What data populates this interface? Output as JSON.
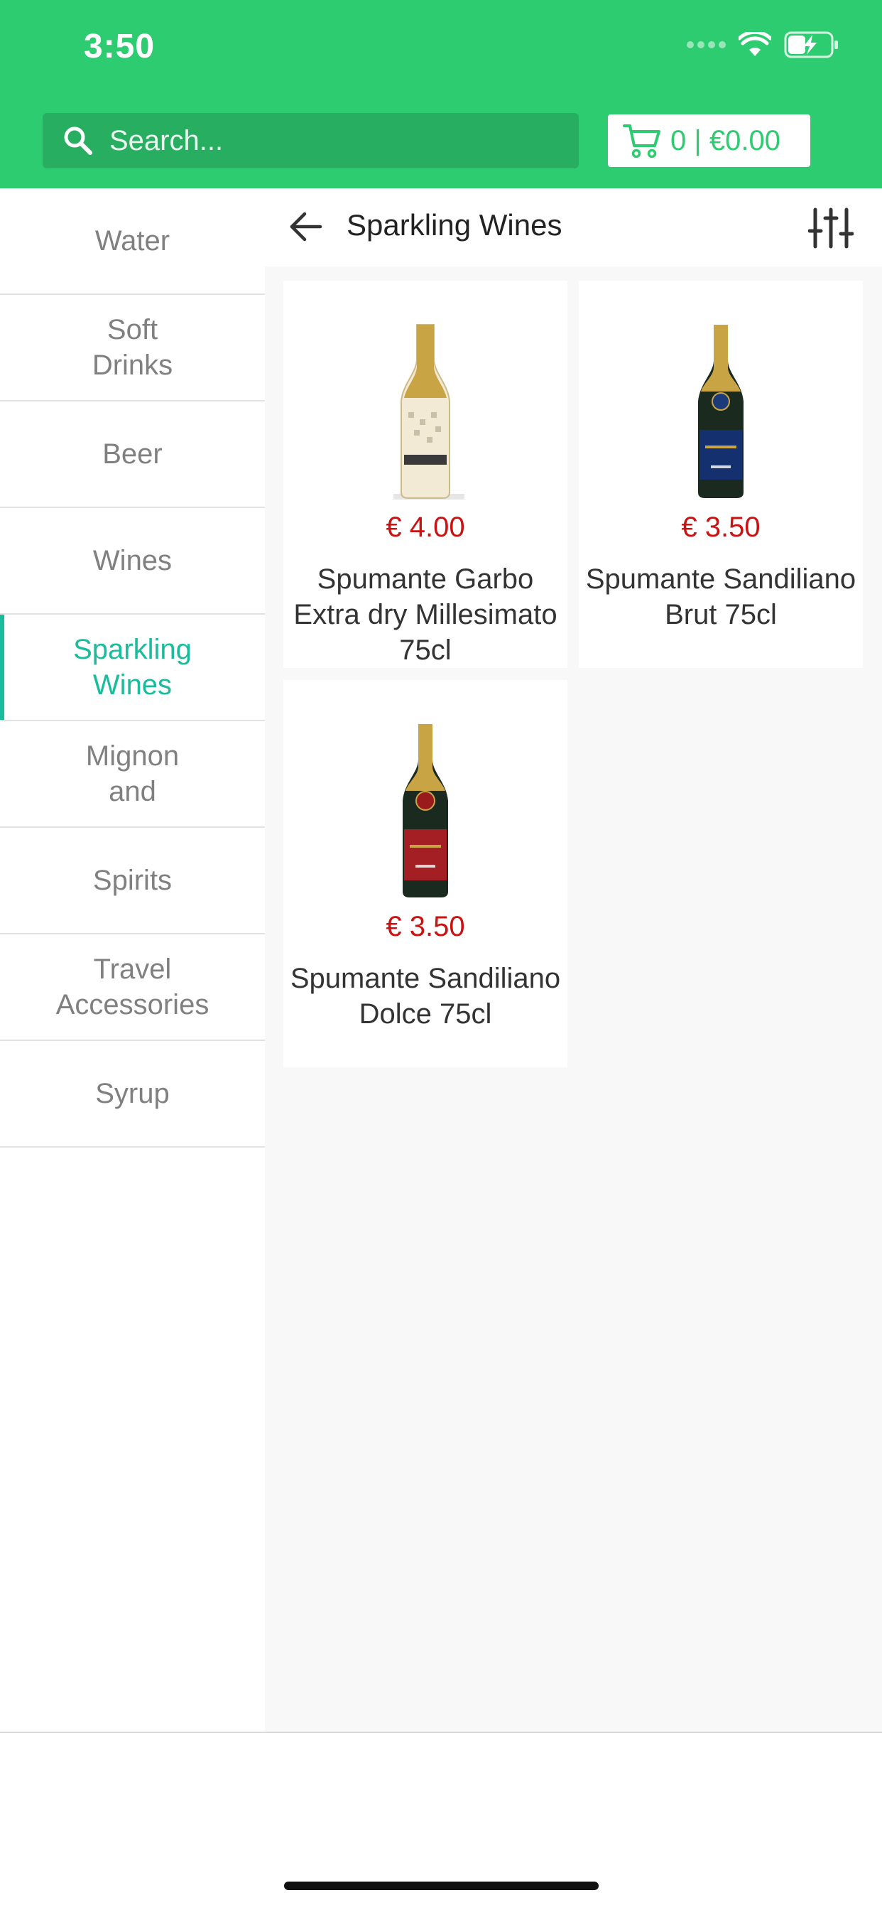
{
  "status_bar": {
    "time": "3:50"
  },
  "search": {
    "placeholder": "Search..."
  },
  "cart": {
    "label": "0 | €0.00"
  },
  "sidebar": {
    "items": [
      {
        "label": "Water",
        "active": false
      },
      {
        "label": "Soft\nDrinks",
        "active": false
      },
      {
        "label": "Beer",
        "active": false
      },
      {
        "label": "Wines",
        "active": false
      },
      {
        "label": "Sparkling\nWines",
        "active": true
      },
      {
        "label": "Mignon\nand",
        "active": false
      },
      {
        "label": "Spirits",
        "active": false
      },
      {
        "label": "Travel\nAccessories",
        "active": false
      },
      {
        "label": "Syrup",
        "active": false
      }
    ]
  },
  "category": {
    "title": "Sparkling Wines"
  },
  "products": [
    {
      "price": "€ 4.00",
      "name": "Spumante Garbo Extra dry Millesimato 75cl",
      "bottle": "gold-bottle"
    },
    {
      "price": "€ 3.50",
      "name": "Spumante Sandiliano Brut 75cl",
      "bottle": "blue-label-bottle"
    },
    {
      "price": "€ 3.50",
      "name": "Spumante Sandiliano Dolce 75cl",
      "bottle": "red-label-bottle"
    }
  ],
  "colors": {
    "header": "#2ecc71",
    "search_bg": "#27ae60",
    "accent": "#1abc9c",
    "price": "#cc1111"
  }
}
